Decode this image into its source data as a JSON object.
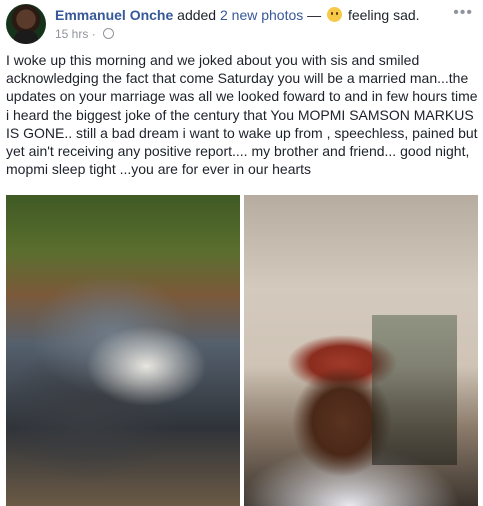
{
  "post": {
    "author": "Emmanuel Onche",
    "added_text": " added ",
    "photos_link": "2 new photos",
    "dash": " — ",
    "feeling_emoji_icon": "sad-face-icon",
    "feeling_text": " feeling sad.",
    "time": "15 hrs",
    "separator": " · ",
    "privacy_icon": "globe-icon",
    "more_icon": "•••",
    "body": "I woke up this morning and we joked about you with sis and smiled acknowledging the fact that come Saturday you will be a married man...the updates on your marriage was all we looked foward to and in few hours time i heard the biggest joke of the century that You MOPMI SAMSON MARKUS IS GONE.. still a bad dream i want to wake up from , speechless, pained but yet ain't receiving any positive report.... my brother and friend... good night, mopmi sleep tight ...you are for ever in our hearts"
  },
  "colors": {
    "author_link": "#365899",
    "meta_gray": "#90949c",
    "text": "#1d2129"
  }
}
